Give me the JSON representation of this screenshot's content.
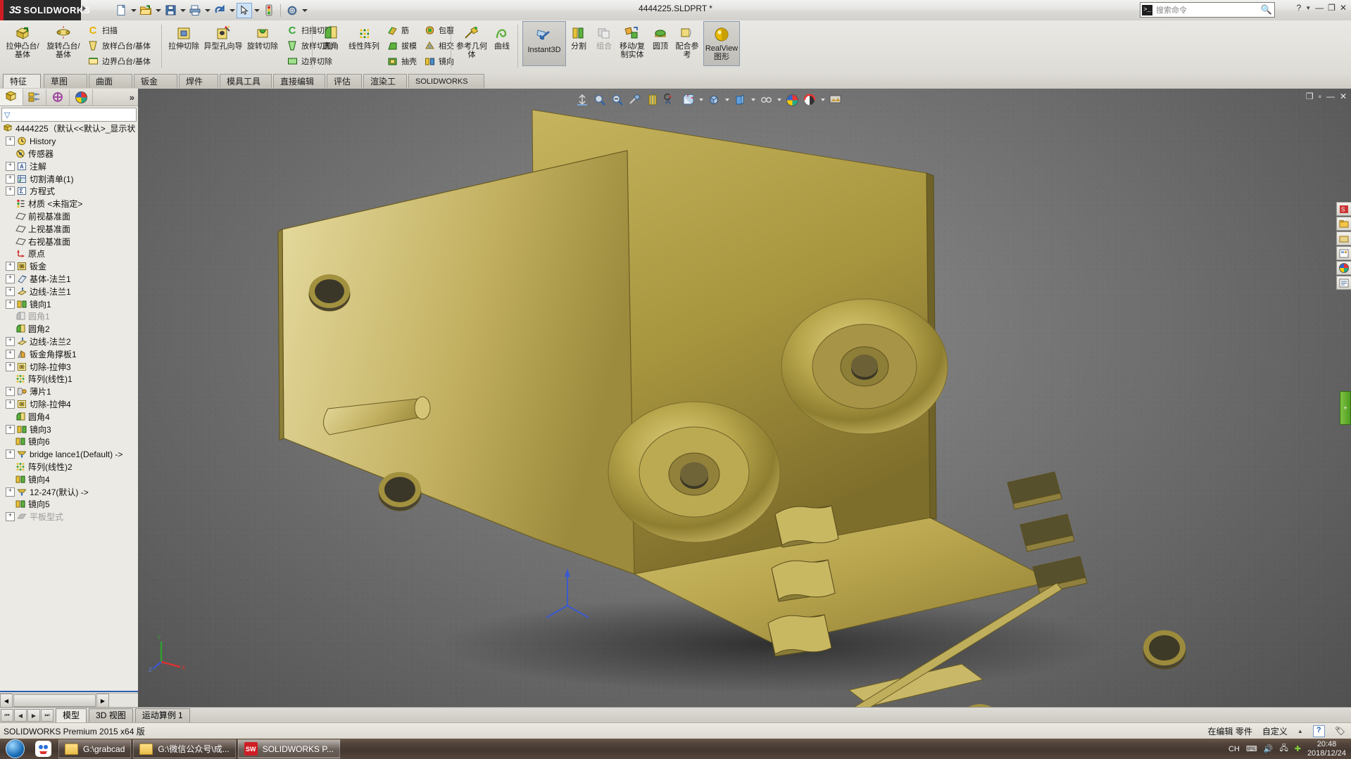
{
  "titlebar": {
    "brand_mark": "3S",
    "brand_word": "SOLIDWORKS",
    "document_title": "4444225.SLDPRT *",
    "quick_tools": [
      {
        "name": "new-document",
        "glyph": "📄"
      },
      {
        "name": "open-document",
        "glyph": "📂"
      },
      {
        "name": "save-document",
        "glyph": "💾"
      },
      {
        "name": "print-document",
        "glyph": "🖨"
      },
      {
        "name": "undo",
        "glyph": "↩"
      },
      {
        "name": "select",
        "glyph": "↖"
      },
      {
        "name": "rebuild",
        "glyph": "🚦"
      },
      {
        "name": "options",
        "glyph": "⚙"
      }
    ],
    "search": {
      "placeholder": "搜索命令",
      "icon": "command-search-icon"
    },
    "window_buttons": {
      "help": "?",
      "minimize": "—",
      "restore": "❐",
      "close": "✕"
    }
  },
  "ribbon": {
    "groups": [
      {
        "name": "boss-base",
        "big": [
          {
            "label": "拉伸凸台/基体",
            "icon": "extruded-boss-icon"
          },
          {
            "label": "旋转凸台/基体",
            "icon": "revolved-boss-icon"
          }
        ],
        "small": [
          {
            "label": "扫描",
            "icon": "swept-boss-icon"
          },
          {
            "label": "放样凸台/基体",
            "icon": "lofted-boss-icon"
          },
          {
            "label": "边界凸台/基体",
            "icon": "boundary-boss-icon"
          }
        ]
      },
      {
        "name": "cut",
        "big": [
          {
            "label": "拉伸切除",
            "icon": "extruded-cut-icon"
          },
          {
            "label": "异型孔向导",
            "icon": "hole-wizard-icon"
          },
          {
            "label": "旋转切除",
            "icon": "revolved-cut-icon"
          }
        ],
        "small": [
          {
            "label": "扫描切除",
            "icon": "swept-cut-icon"
          },
          {
            "label": "放样切割",
            "icon": "lofted-cut-icon"
          },
          {
            "label": "边界切除",
            "icon": "boundary-cut-icon"
          }
        ]
      },
      {
        "name": "features",
        "big": [
          {
            "label": "圆角",
            "icon": "fillet-icon"
          },
          {
            "label": "线性阵列",
            "icon": "linear-pattern-icon"
          }
        ],
        "small": [
          {
            "label": "筋",
            "icon": "rib-icon"
          },
          {
            "label": "拔模",
            "icon": "draft-icon"
          },
          {
            "label": "抽壳",
            "icon": "shell-icon"
          },
          {
            "label": "包覆",
            "icon": "wrap-icon"
          },
          {
            "label": "相交",
            "icon": "intersect-icon"
          },
          {
            "label": "镜向",
            "icon": "mirror-icon"
          }
        ]
      },
      {
        "name": "reference",
        "big": [
          {
            "label": "参考几何体",
            "icon": "reference-geometry-icon"
          },
          {
            "label": "曲线",
            "icon": "curves-icon"
          }
        ],
        "small": []
      },
      {
        "name": "instant3d",
        "big": [
          {
            "label": "Instant3D",
            "icon": "instant3d-icon",
            "selected": true
          },
          {
            "label": "分割",
            "icon": "split-icon"
          },
          {
            "label": "组合",
            "icon": "combine-icon",
            "disabled": true
          },
          {
            "label": "移动/复制实体",
            "icon": "move-copy-body-icon"
          },
          {
            "label": "圆顶",
            "icon": "dome-icon"
          },
          {
            "label": "配合参考",
            "icon": "mate-reference-icon"
          },
          {
            "label": "RealView 图形",
            "icon": "realview-icon",
            "selected": true
          }
        ],
        "small": []
      }
    ]
  },
  "command_tabs": [
    {
      "label": "特征",
      "active": true
    },
    {
      "label": "草图",
      "active": false
    },
    {
      "label": "曲面",
      "active": false
    },
    {
      "label": "钣金",
      "active": false
    },
    {
      "label": "焊件",
      "active": false
    },
    {
      "label": "模具工具",
      "active": false
    },
    {
      "label": "直接编辑",
      "active": false
    },
    {
      "label": "评估",
      "active": false
    },
    {
      "label": "渲染工具",
      "active": false
    },
    {
      "label": "SOLIDWORKS 插件",
      "active": false
    }
  ],
  "feature_manager": {
    "tabs": [
      {
        "name": "feature-manager-tab",
        "icon": "feature-tree-icon",
        "active": true
      },
      {
        "name": "property-manager-tab",
        "icon": "property-manager-icon",
        "active": false
      },
      {
        "name": "configuration-manager-tab",
        "icon": "configuration-icon",
        "active": false
      },
      {
        "name": "display-manager-tab",
        "icon": "display-manager-icon",
        "active": false
      }
    ],
    "more_label": "»",
    "filter_placeholder": "",
    "tree": [
      {
        "label": "4444225（默认<<默认>_显示状",
        "icon": "part-icon",
        "expand": "none",
        "root": true,
        "disabled": false
      },
      {
        "label": "History",
        "icon": "history-icon",
        "expand": "plus",
        "indent": 1,
        "disabled": false
      },
      {
        "label": "传感器",
        "icon": "sensors-icon",
        "expand": "none",
        "indent": 1,
        "disabled": false
      },
      {
        "label": "注解",
        "icon": "annotations-icon",
        "expand": "plus",
        "indent": 1,
        "disabled": false
      },
      {
        "label": "切割清单(1)",
        "icon": "cut-list-icon",
        "expand": "plus",
        "indent": 1,
        "disabled": false
      },
      {
        "label": "方程式",
        "icon": "equations-icon",
        "expand": "plus",
        "indent": 1,
        "disabled": false
      },
      {
        "label": "材质 <未指定>",
        "icon": "material-icon",
        "expand": "none",
        "indent": 1,
        "disabled": false
      },
      {
        "label": "前视基准面",
        "icon": "plane-icon",
        "expand": "none",
        "indent": 1,
        "disabled": false
      },
      {
        "label": "上视基准面",
        "icon": "plane-icon",
        "expand": "none",
        "indent": 1,
        "disabled": false
      },
      {
        "label": "右视基准面",
        "icon": "plane-icon",
        "expand": "none",
        "indent": 1,
        "disabled": false
      },
      {
        "label": "原点",
        "icon": "origin-icon",
        "expand": "none",
        "indent": 1,
        "disabled": false
      },
      {
        "label": "钣金",
        "icon": "sheet-metal-icon",
        "expand": "plus",
        "indent": 1,
        "disabled": false
      },
      {
        "label": "基体-法兰1",
        "icon": "base-flange-icon",
        "expand": "plus",
        "indent": 1,
        "disabled": false
      },
      {
        "label": "边线-法兰1",
        "icon": "edge-flange-icon",
        "expand": "plus",
        "indent": 1,
        "disabled": false
      },
      {
        "label": "镜向1",
        "icon": "mirror-icon",
        "expand": "plus",
        "indent": 1,
        "disabled": false
      },
      {
        "label": "圆角1",
        "icon": "fillet-icon-gray",
        "expand": "none",
        "indent": 1,
        "disabled": true
      },
      {
        "label": "圆角2",
        "icon": "fillet-icon",
        "expand": "none",
        "indent": 1,
        "disabled": false
      },
      {
        "label": "边线-法兰2",
        "icon": "edge-flange-icon",
        "expand": "plus",
        "indent": 1,
        "disabled": false
      },
      {
        "label": "钣金角撑板1",
        "icon": "gusset-icon",
        "expand": "plus",
        "indent": 1,
        "disabled": false
      },
      {
        "label": "切除-拉伸3",
        "icon": "extruded-cut-icon",
        "expand": "plus",
        "indent": 1,
        "disabled": false
      },
      {
        "label": "阵列(线性)1",
        "icon": "linear-pattern-icon",
        "expand": "none",
        "indent": 1,
        "disabled": false
      },
      {
        "label": "薄片1",
        "icon": "tab-icon",
        "expand": "plus",
        "indent": 1,
        "disabled": false
      },
      {
        "label": "切除-拉伸4",
        "icon": "extruded-cut-icon",
        "expand": "plus",
        "indent": 1,
        "disabled": false
      },
      {
        "label": "圆角4",
        "icon": "fillet-icon",
        "expand": "none",
        "indent": 1,
        "disabled": false
      },
      {
        "label": "镜向3",
        "icon": "mirror-icon",
        "expand": "plus",
        "indent": 1,
        "disabled": false
      },
      {
        "label": "镜向6",
        "icon": "mirror-icon",
        "expand": "none",
        "indent": 1,
        "disabled": false
      },
      {
        "label": "bridge lance1(Default) ->",
        "icon": "lance-icon",
        "expand": "plus",
        "indent": 1,
        "disabled": false
      },
      {
        "label": "阵列(线性)2",
        "icon": "linear-pattern-icon",
        "expand": "none",
        "indent": 1,
        "disabled": false
      },
      {
        "label": "镜向4",
        "icon": "mirror-icon",
        "expand": "none",
        "indent": 1,
        "disabled": false
      },
      {
        "label": "12-247(默认) ->",
        "icon": "lance-icon",
        "expand": "plus",
        "indent": 1,
        "disabled": false
      },
      {
        "label": "镜向5",
        "icon": "mirror-icon",
        "expand": "none",
        "indent": 1,
        "disabled": false
      },
      {
        "label": "平板型式",
        "icon": "flat-pattern-icon",
        "expand": "plus",
        "indent": 1,
        "disabled": true
      }
    ]
  },
  "view_toolbar": [
    {
      "name": "zoom-to-fit-icon",
      "caret": false
    },
    {
      "name": "zoom-to-area-icon",
      "caret": false
    },
    {
      "name": "previous-view-icon",
      "caret": false
    },
    {
      "name": "section-view-icon",
      "caret": false
    },
    {
      "name": "view-orientation-icon",
      "caret": false
    },
    {
      "name": "annotation-view-icon",
      "caret": false
    },
    {
      "name": "display-style-icon",
      "caret": true
    },
    {
      "name": "hide-show-items-icon",
      "caret": true
    },
    {
      "name": "edit-appearance-icon",
      "caret": true
    },
    {
      "name": "apply-scene-icon",
      "caret": true
    },
    {
      "name": "view-settings-icon",
      "caret": true
    },
    {
      "name": "scene-background-icon",
      "caret": false
    }
  ],
  "graphics": {
    "window_buttons": {
      "restore_down": "❐",
      "minimize": "—",
      "maximize": "▫",
      "close": "✕"
    },
    "task_pane": [
      {
        "name": "design-library-icon"
      },
      {
        "name": "file-explorer-icon"
      },
      {
        "name": "view-palette-icon"
      },
      {
        "name": "appearances-scenes-icon"
      },
      {
        "name": "custom-properties-icon"
      }
    ],
    "green_tab_label": "+",
    "triad": {
      "x": "X",
      "y": "Y",
      "z": "Z"
    }
  },
  "bottom_tabs": {
    "nav": [
      "⏮",
      "◀",
      "▶",
      "⏭"
    ],
    "tabs": [
      {
        "label": "模型",
        "active": true
      },
      {
        "label": "3D 视图",
        "active": false
      },
      {
        "label": "运动算例 1",
        "active": false
      }
    ]
  },
  "status_bar": {
    "left": "SOLIDWORKS Premium 2015 x64 版",
    "editing": "在编辑 零件",
    "custom": "自定义",
    "help_badge": "?"
  },
  "taskbar": {
    "start": "start-orb",
    "quicklaunch_icon": "baidu-netdisk-icon",
    "items": [
      {
        "label": "G:\\grabcad",
        "icon": "folder-icon",
        "active": false
      },
      {
        "label": "G:\\微信公众号\\成...",
        "icon": "folder-icon",
        "active": false
      },
      {
        "label": "SOLIDWORKS P...",
        "icon": "solidworks-icon",
        "active": true
      }
    ],
    "tray": {
      "ime": "CH",
      "icons": [
        "keyboard-icon",
        "volume-icon",
        "network-icon",
        "security-icon"
      ],
      "time": "20:48",
      "date": "2018/12/24"
    }
  }
}
